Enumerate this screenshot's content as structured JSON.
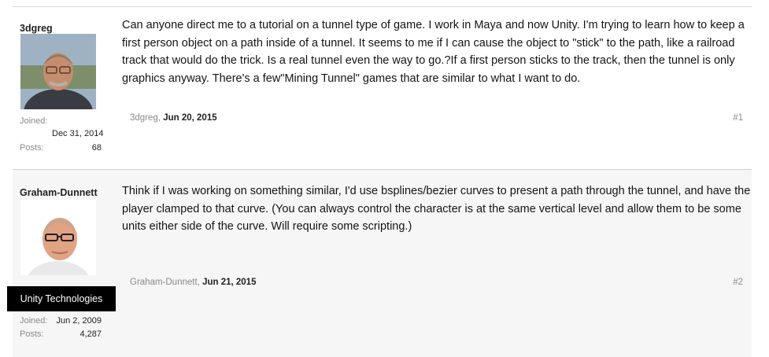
{
  "posts": [
    {
      "username": "3dgreg",
      "joined_label": "Joined:",
      "joined_value": "Dec 31, 2014",
      "posts_label": "Posts:",
      "posts_value": "68",
      "message": "Can anyone direct me to a tutorial on a tunnel type of game. I work in Maya and now Unity. I'm trying to learn how to keep a first person object on a path inside of a tunnel. It seems to me if I can cause the object to \"stick\" to the path, like a railroad track that would do the trick. Is a real tunnel even the way to go.?If a first person sticks to the track, then the tunnel is only graphics anyway. There's a few\"Mining Tunnel\" games that are similar to what I want to do.",
      "author": "3dgreg,",
      "date": "Jun 20, 2015",
      "number": "#1"
    },
    {
      "username": "Graham-Dunnett",
      "banner": "Unity Technologies",
      "joined_label": "Joined:",
      "joined_value": "Jun 2, 2009",
      "posts_label": "Posts:",
      "posts_value": "4,287",
      "message": "Think if I was working on something similar, I'd use bsplines/bezier curves to present a path through the tunnel, and have the player clamped to that curve. (You can always control the character is at the same vertical level and allow them to be some units either side of the curve. Will require some scripting.)",
      "author": "Graham-Dunnett,",
      "date": "Jun 21, 2015",
      "number": "#2"
    }
  ]
}
